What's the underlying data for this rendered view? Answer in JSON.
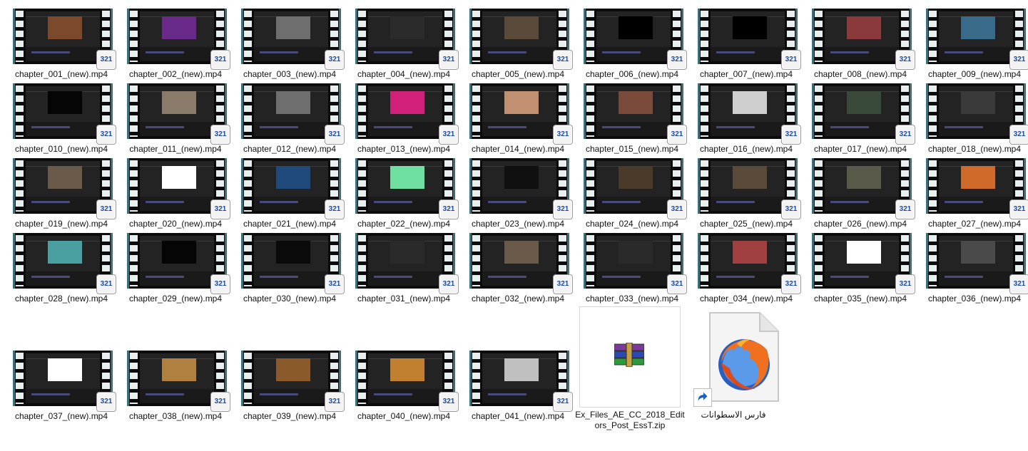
{
  "files": [
    {
      "name": "chapter_001_(new).mp4",
      "preview": "#7a4a2a"
    },
    {
      "name": "chapter_002_(new).mp4",
      "preview": "#6a2a8a"
    },
    {
      "name": "chapter_003_(new).mp4",
      "preview": "#6e6e6e"
    },
    {
      "name": "chapter_004_(new).mp4",
      "preview": "#2b2b2b"
    },
    {
      "name": "chapter_005_(new).mp4",
      "preview": "#5a4a3a"
    },
    {
      "name": "chapter_006_(new).mp4",
      "preview": "#000000"
    },
    {
      "name": "chapter_007_(new).mp4",
      "preview": "#000000"
    },
    {
      "name": "chapter_008_(new).mp4",
      "preview": "#8a3a3a"
    },
    {
      "name": "chapter_009_(new).mp4",
      "preview": "#3a6a8a"
    },
    {
      "name": "chapter_010_(new).mp4",
      "preview": "#050505"
    },
    {
      "name": "chapter_011_(new).mp4",
      "preview": "#8a7a6a"
    },
    {
      "name": "chapter_012_(new).mp4",
      "preview": "#6e6e6e"
    },
    {
      "name": "chapter_013_(new).mp4",
      "preview": "#d0207a"
    },
    {
      "name": "chapter_014_(new).mp4",
      "preview": "#c09070"
    },
    {
      "name": "chapter_015_(new).mp4",
      "preview": "#7a4a3a"
    },
    {
      "name": "chapter_016_(new).mp4",
      "preview": "#cfcfcf"
    },
    {
      "name": "chapter_017_(new).mp4",
      "preview": "#3a4a3a"
    },
    {
      "name": "chapter_018_(new).mp4",
      "preview": "#3a3a3a"
    },
    {
      "name": "chapter_019_(new).mp4",
      "preview": "#6a5a4a"
    },
    {
      "name": "chapter_020_(new).mp4",
      "preview": "#ffffff"
    },
    {
      "name": "chapter_021_(new).mp4",
      "preview": "#1f4a7a"
    },
    {
      "name": "chapter_022_(new).mp4",
      "preview": "#70e0a0"
    },
    {
      "name": "chapter_023_(new).mp4",
      "preview": "#101010"
    },
    {
      "name": "chapter_024_(new).mp4",
      "preview": "#4a3a2a"
    },
    {
      "name": "chapter_025_(new).mp4",
      "preview": "#5a4a3a"
    },
    {
      "name": "chapter_026_(new).mp4",
      "preview": "#5a5a4a"
    },
    {
      "name": "chapter_027_(new).mp4",
      "preview": "#d06a2a"
    },
    {
      "name": "chapter_028_(new).mp4",
      "preview": "#4aa0a0"
    },
    {
      "name": "chapter_029_(new).mp4",
      "preview": "#050505"
    },
    {
      "name": "chapter_030_(new).mp4",
      "preview": "#0a0a0a"
    },
    {
      "name": "chapter_031_(new).mp4",
      "preview": "#2a2a2a"
    },
    {
      "name": "chapter_032_(new).mp4",
      "preview": "#6a5a4a"
    },
    {
      "name": "chapter_033_(new).mp4",
      "preview": "#2a2a2a"
    },
    {
      "name": "chapter_034_(new).mp4",
      "preview": "#a04040"
    },
    {
      "name": "chapter_035_(new).mp4",
      "preview": "#ffffff"
    },
    {
      "name": "chapter_036_(new).mp4",
      "preview": "#4a4a4a"
    },
    {
      "name": "chapter_037_(new).mp4",
      "preview": "#ffffff"
    },
    {
      "name": "chapter_038_(new).mp4",
      "preview": "#b08040"
    },
    {
      "name": "chapter_039_(new).mp4",
      "preview": "#8a5a2a"
    },
    {
      "name": "chapter_040_(new).mp4",
      "preview": "#c08030"
    },
    {
      "name": "chapter_041_(new).mp4",
      "preview": "#c0c0c0"
    }
  ],
  "badge_text": "321",
  "zip": {
    "name": "Ex_Files_AE_CC_2018_Editors_Post_EssT.zip",
    "icon": "winrar-icon"
  },
  "shortcut": {
    "name": "فارس الاسطوانات",
    "icon": "firefox-icon"
  }
}
